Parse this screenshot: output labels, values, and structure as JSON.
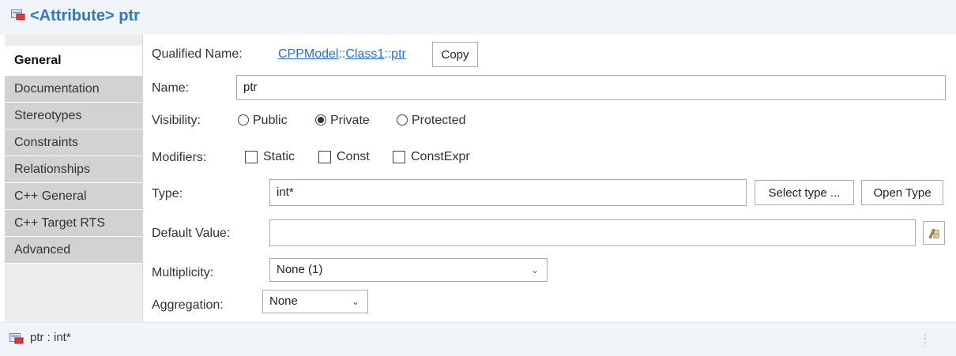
{
  "header": {
    "title": "<Attribute> ptr",
    "icon": "attribute-icon"
  },
  "tabs": [
    {
      "label": "General",
      "active": true
    },
    {
      "label": "Documentation"
    },
    {
      "label": "Stereotypes"
    },
    {
      "label": "Constraints"
    },
    {
      "label": "Relationships"
    },
    {
      "label": "C++ General"
    },
    {
      "label": "C++ Target RTS"
    },
    {
      "label": "Advanced"
    }
  ],
  "general": {
    "qualified_name_label": "Qualified Name:",
    "qualified_name_parts": [
      "CPPModel",
      "::",
      "Class1",
      "::",
      "ptr"
    ],
    "copy_button": "Copy",
    "name_label": "Name:",
    "name_value": "ptr",
    "visibility_label": "Visibility:",
    "visibility_options": [
      "Public",
      "Private",
      "Protected"
    ],
    "visibility_selected": "Private",
    "modifiers_label": "Modifiers:",
    "modifiers": [
      {
        "label": "Static",
        "checked": false
      },
      {
        "label": "Const",
        "checked": false
      },
      {
        "label": "ConstExpr",
        "checked": false
      }
    ],
    "type_label": "Type:",
    "type_value": "int*",
    "select_type_button": "Select type ...",
    "open_type_button": "Open Type",
    "default_value_label": "Default Value:",
    "default_value": "",
    "multiplicity_label": "Multiplicity:",
    "multiplicity_value": "None (1)",
    "aggregation_label": "Aggregation:",
    "aggregation_value": "None"
  },
  "status": {
    "text": "ptr : int*",
    "icon": "attribute-icon"
  },
  "colors": {
    "title": "#2f76c4",
    "link": "#2a6fd0",
    "tab_bg": "#d2d2d2",
    "header_bg": "#f1f4f8"
  }
}
